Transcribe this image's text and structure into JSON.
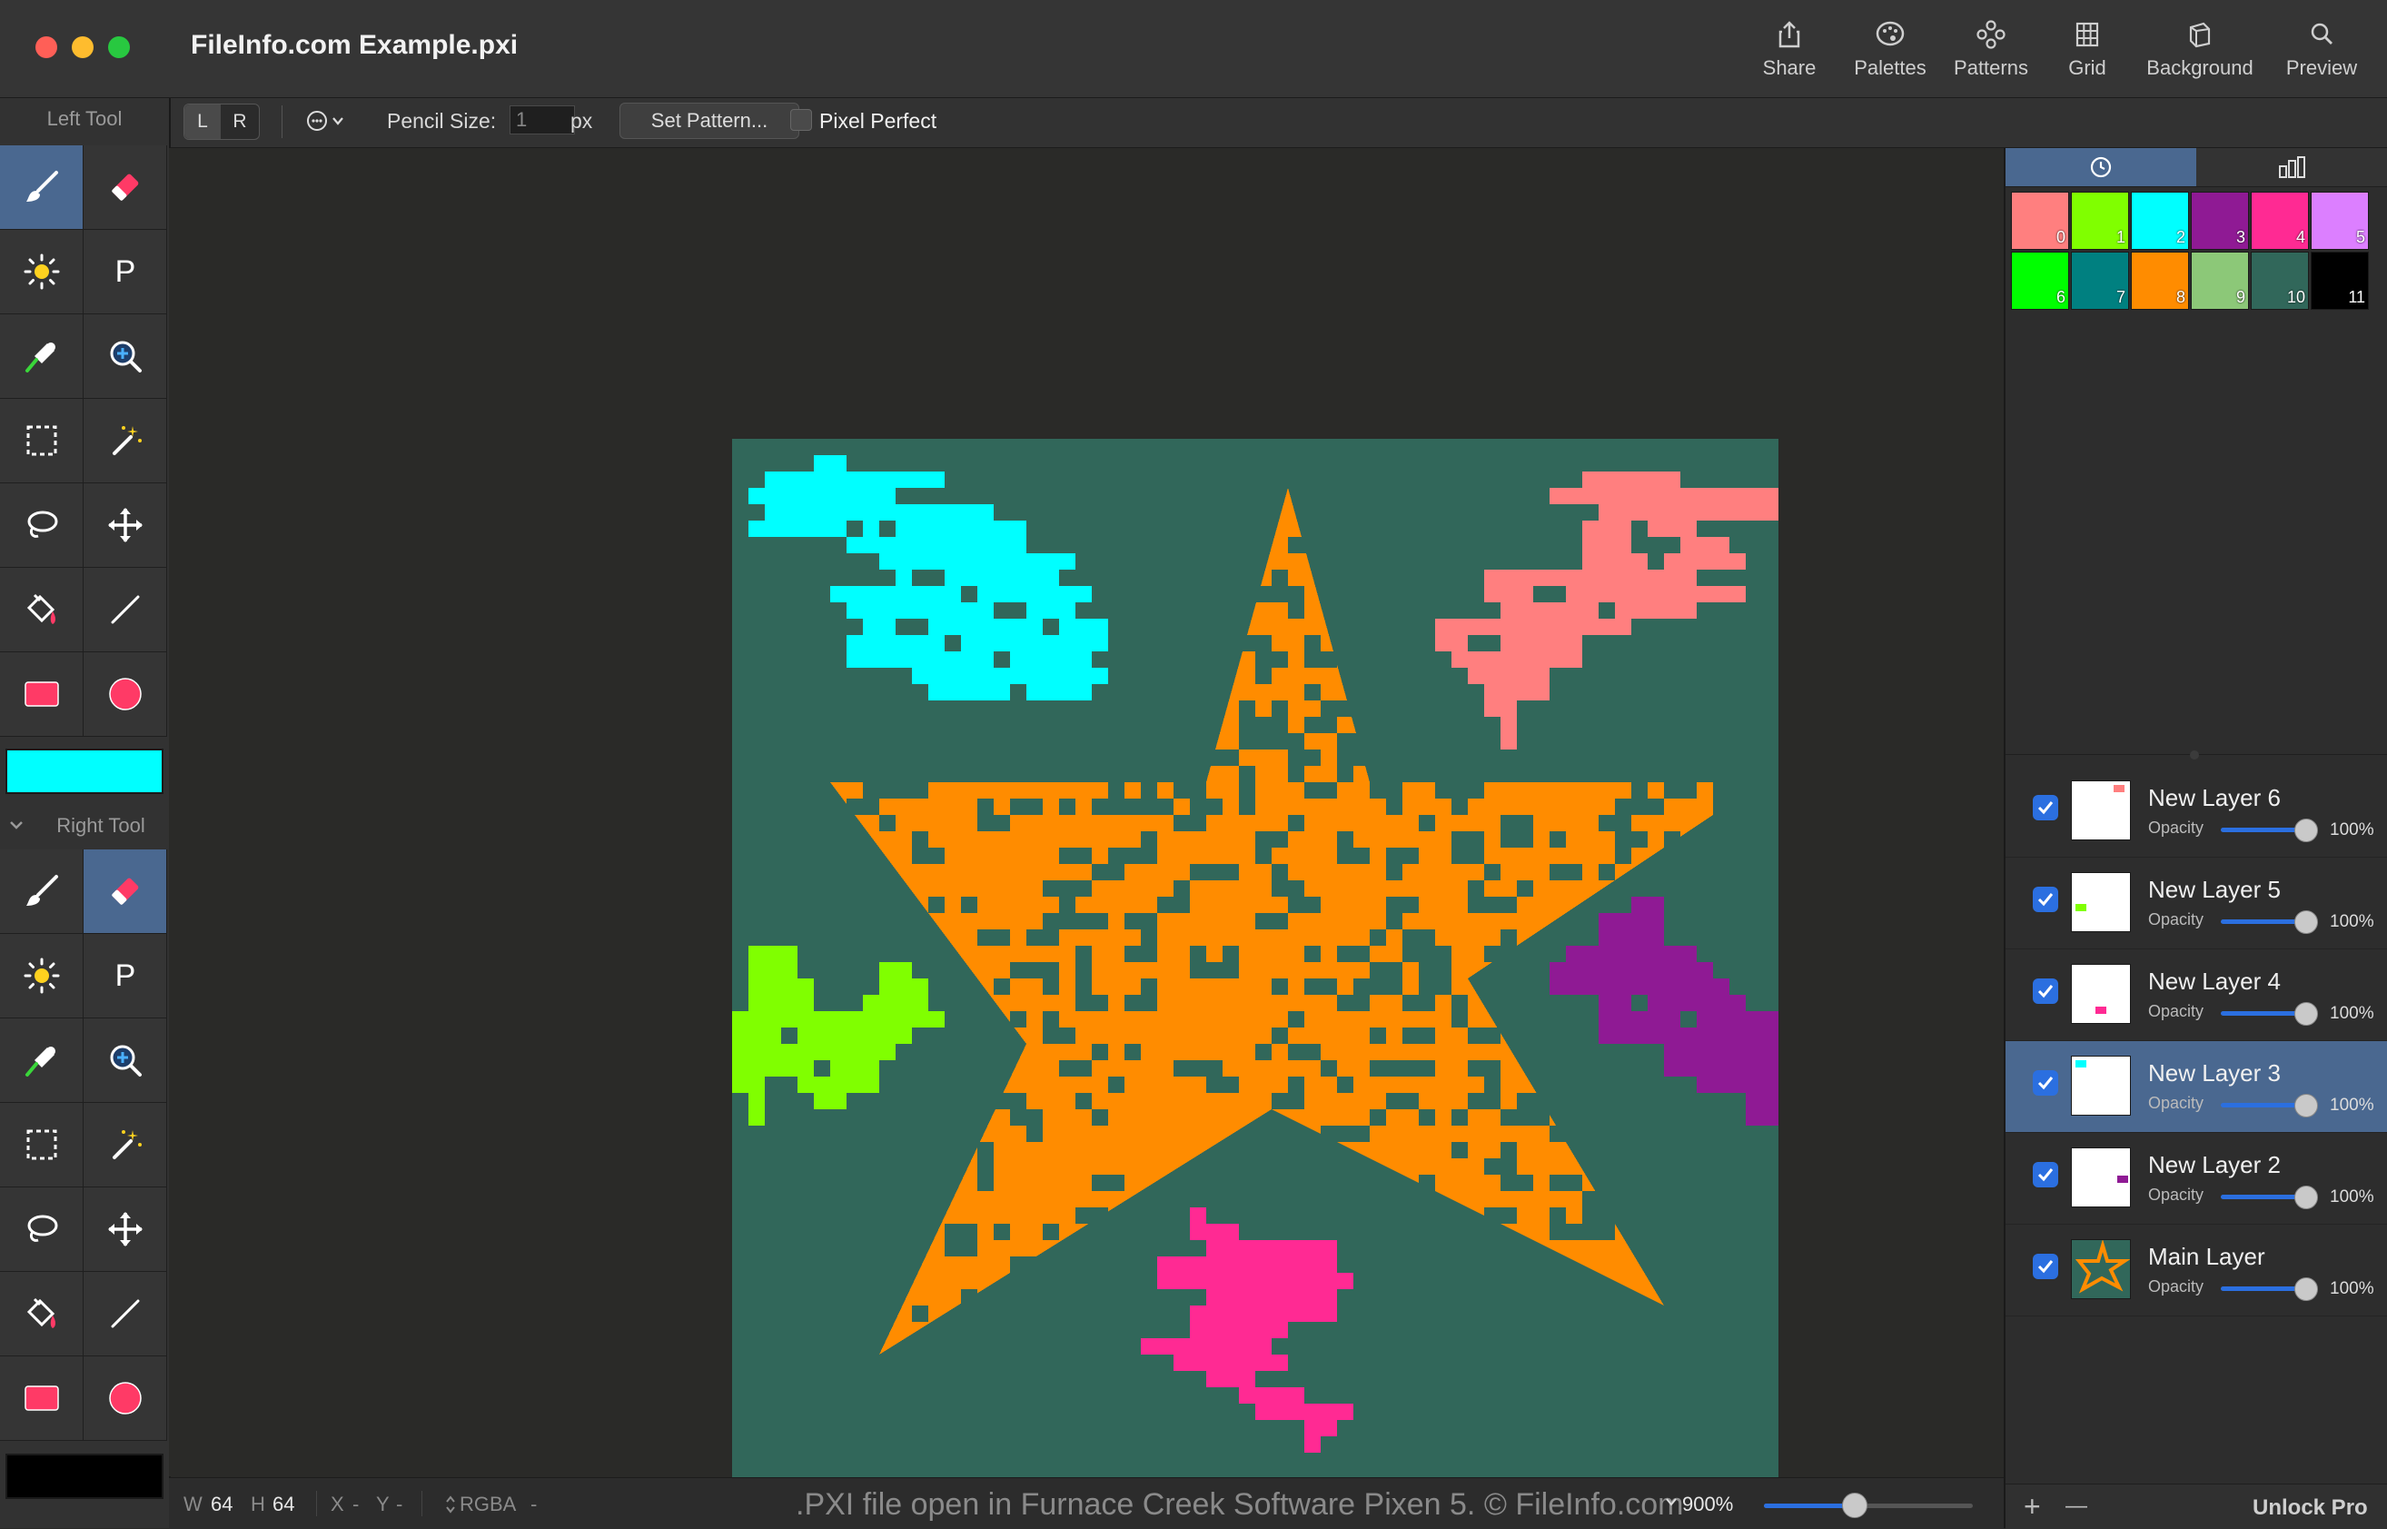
{
  "window": {
    "title": "FileInfo.com Example.pxi"
  },
  "toolbar": {
    "share": "Share",
    "palettes": "Palettes",
    "patterns": "Patterns",
    "grid": "Grid",
    "background": "Background",
    "preview": "Preview"
  },
  "options": {
    "left_btn": "L",
    "right_btn": "R",
    "pencil_size_label": "Pencil Size:",
    "pencil_size_value": "1",
    "pencil_size_unit": "px",
    "set_pattern": "Set Pattern...",
    "pixel_perfect": "Pixel Perfect"
  },
  "left_panel": {
    "left_tool_label": "Left Tool",
    "right_tool_label": "Right Tool",
    "left_color": "#00ffff",
    "right_color": "#000000"
  },
  "palette": {
    "swatches": [
      {
        "num": "0",
        "color": "#ff7f7f"
      },
      {
        "num": "1",
        "color": "#80ff00"
      },
      {
        "num": "2",
        "color": "#00ffff"
      },
      {
        "num": "3",
        "color": "#8f1a94"
      },
      {
        "num": "4",
        "color": "#ff2a93"
      },
      {
        "num": "5",
        "color": "#dc7fff"
      },
      {
        "num": "6",
        "color": "#00ff00"
      },
      {
        "num": "7",
        "color": "#008080"
      },
      {
        "num": "8",
        "color": "#ff8c00"
      },
      {
        "num": "9",
        "color": "#8cc878"
      },
      {
        "num": "10",
        "color": "#31675a"
      },
      {
        "num": "11",
        "color": "#000000"
      }
    ]
  },
  "layers": [
    {
      "name": "New Layer 6",
      "opacity_label": "Opacity",
      "opacity": "100%",
      "thumb_color": "#ff7f7f",
      "selected": false
    },
    {
      "name": "New Layer 5",
      "opacity_label": "Opacity",
      "opacity": "100%",
      "thumb_color": "#80ff00",
      "selected": false
    },
    {
      "name": "New Layer 4",
      "opacity_label": "Opacity",
      "opacity": "100%",
      "thumb_color": "#ff2a93",
      "selected": false
    },
    {
      "name": "New Layer 3",
      "opacity_label": "Opacity",
      "opacity": "100%",
      "thumb_color": "#00ffff",
      "selected": true
    },
    {
      "name": "New Layer 2",
      "opacity_label": "Opacity",
      "opacity": "100%",
      "thumb_color": "#8f1a94",
      "selected": false
    },
    {
      "name": "Main Layer",
      "opacity_label": "Opacity",
      "opacity": "100%",
      "thumb_color": "#ff8c00",
      "selected": false
    }
  ],
  "right_bottom": {
    "add": "+",
    "remove": "—",
    "unlock": "Unlock Pro"
  },
  "status": {
    "w_label": "W",
    "w_value": "64",
    "h_label": "H",
    "h_value": "64",
    "x_label": "X",
    "x_value": "-",
    "y_label": "Y",
    "y_value": "-",
    "color_mode": "RGBA",
    "color_value": "-",
    "watermark": ".PXI file open in Furnace Creek Software Pixen 5. © FileInfo.com",
    "zoom": "900%",
    "zoom_level": 0.43
  },
  "canvas": {
    "background": "#31675a",
    "star_color": "#ff8c00"
  }
}
